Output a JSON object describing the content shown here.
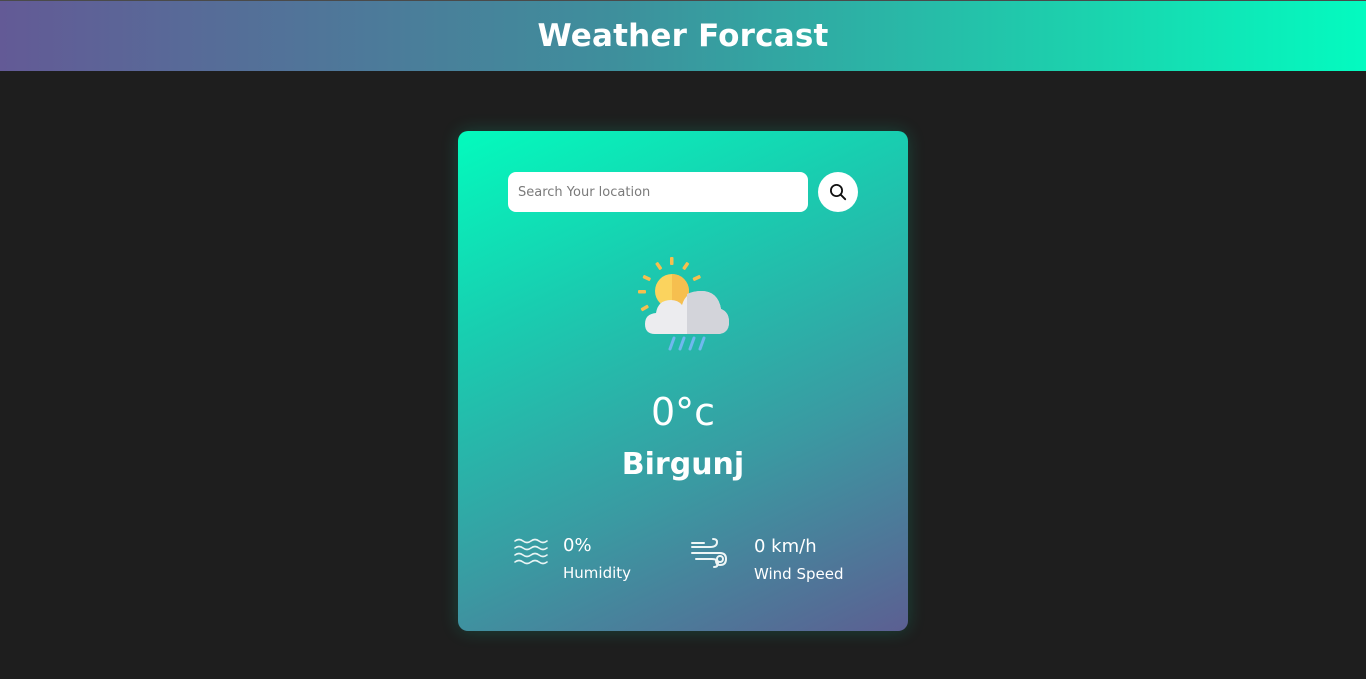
{
  "header": {
    "title": "Weather Forcast"
  },
  "search": {
    "placeholder": "Search Your location",
    "value": "",
    "button_icon": "search-icon"
  },
  "weather": {
    "icon": "partly-cloudy-rain-icon",
    "temperature": "0°c",
    "city": "Birgunj"
  },
  "details": {
    "humidity": {
      "icon": "humidity-waves-icon",
      "value": "0%",
      "label": "Humidity"
    },
    "wind": {
      "icon": "wind-icon",
      "value": "0 km/h",
      "label": "Wind Speed"
    }
  },
  "colors": {
    "page_background": "#1e1e1e",
    "gradient_start": "#03fbbd",
    "gradient_end": "#5c5f92",
    "text": "#ffffff"
  }
}
